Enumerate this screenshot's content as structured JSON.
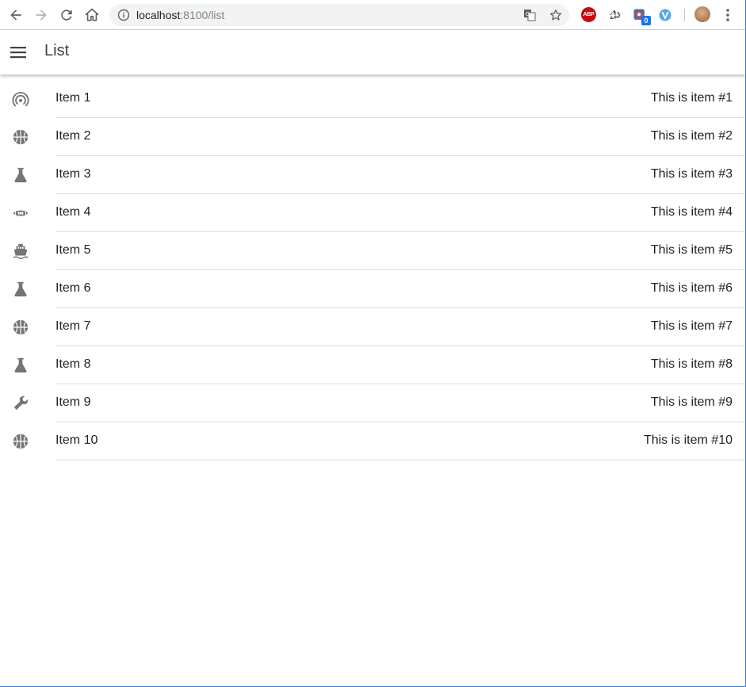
{
  "browser": {
    "url_host": "localhost",
    "url_rest": ":8100/list",
    "extensions": {
      "abp_label": "ABP",
      "badge_count": "0"
    }
  },
  "header": {
    "title": "List"
  },
  "list": {
    "items": [
      {
        "title": "Item 1",
        "note": "This is item #1",
        "icon": "wifi-icon"
      },
      {
        "title": "Item 2",
        "note": "This is item #2",
        "icon": "basketball-icon"
      },
      {
        "title": "Item 3",
        "note": "This is item #3",
        "icon": "flask-icon"
      },
      {
        "title": "Item 4",
        "note": "This is item #4",
        "icon": "american-football-icon"
      },
      {
        "title": "Item 5",
        "note": "This is item #5",
        "icon": "boat-icon"
      },
      {
        "title": "Item 6",
        "note": "This is item #6",
        "icon": "flask-icon"
      },
      {
        "title": "Item 7",
        "note": "This is item #7",
        "icon": "basketball-icon"
      },
      {
        "title": "Item 8",
        "note": "This is item #8",
        "icon": "flask-icon"
      },
      {
        "title": "Item 9",
        "note": "This is item #9",
        "icon": "build-icon"
      },
      {
        "title": "Item 10",
        "note": "This is item #10",
        "icon": "basketball-icon"
      }
    ]
  },
  "colors": {
    "icon": "#757575",
    "text": "#222222",
    "divider": "#dedede",
    "window_border": "#3c78d8"
  }
}
